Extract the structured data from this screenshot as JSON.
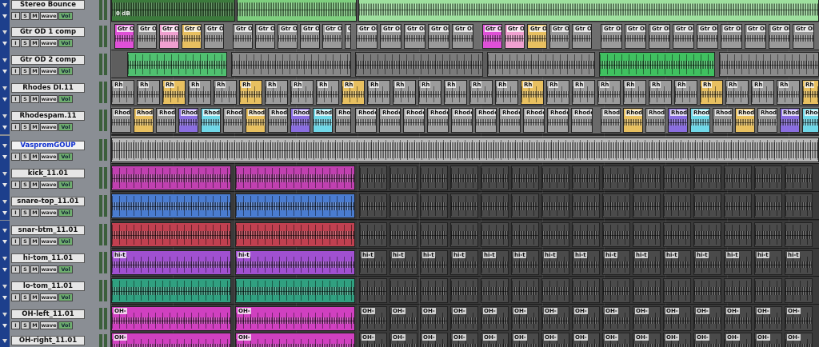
{
  "colors": {
    "header_blue": "#1d3f8c",
    "header_bg": "#8a8e94",
    "stereo_bounce": "#7ecf7e",
    "gtr": "#9a9a9a",
    "gtr_magenta": "#e050d8",
    "gtr_pink": "#f0a0d0",
    "gtr_gold": "#e8c060",
    "rhodes_purple": "#8a6ee0",
    "rhodes_cyan": "#70d8e8",
    "kick": "#c040b0",
    "snare_top": "#4a7cd0",
    "snare_btm": "#c04050",
    "hi_tom": "#a050d0",
    "lo_tom": "#30a080",
    "oh": "#d040c0",
    "drums_default": "#4a4a4a"
  },
  "tracks": [
    {
      "name": "Stereo Bounce",
      "selected": false,
      "button_labels": [
        "I",
        "S",
        "M"
      ],
      "view_label": "wave",
      "volume_label": "Vol",
      "clip_label": ""
    },
    {
      "name": "Gtr OD 1 comp",
      "selected": false,
      "button_labels": [
        "I",
        "S",
        "M"
      ],
      "view_label": "wave",
      "volume_label": "Vol",
      "clip_label": "Gtr Ol"
    },
    {
      "name": "Gtr OD 2 comp",
      "selected": false,
      "button_labels": [
        "I",
        "S",
        "M"
      ],
      "view_label": "wave",
      "volume_label": "Vol",
      "clip_label": ""
    },
    {
      "name": "Rhodes DI.11",
      "selected": false,
      "button_labels": [
        "I",
        "S",
        "M"
      ],
      "view_label": "wave",
      "volume_label": "Vol",
      "clip_label": "Rh"
    },
    {
      "name": "Rhodespam.11",
      "selected": false,
      "button_labels": [
        "I",
        "S",
        "M"
      ],
      "view_label": "wave",
      "volume_label": "Vol",
      "clip_label": "Rhode"
    },
    {
      "name": "VaspromGOUP",
      "selected": true,
      "button_labels": [
        "I",
        "S",
        "M"
      ],
      "view_label": "wave",
      "volume_label": "Vol",
      "clip_label": ""
    },
    {
      "name": "kick_11.01",
      "selected": false,
      "button_labels": [
        "I",
        "S",
        "M"
      ],
      "view_label": "wave",
      "volume_label": "Vol",
      "clip_label": ""
    },
    {
      "name": "snare-top_11.01",
      "selected": false,
      "button_labels": [
        "I",
        "S",
        "M"
      ],
      "view_label": "wave",
      "volume_label": "Vol",
      "clip_label": ""
    },
    {
      "name": "snar-btm_11.01",
      "selected": false,
      "button_labels": [
        "I",
        "S",
        "M"
      ],
      "view_label": "wave",
      "volume_label": "Vol",
      "clip_label": ""
    },
    {
      "name": "hi-tom_11.01",
      "selected": false,
      "button_labels": [
        "I",
        "S",
        "M"
      ],
      "view_label": "wave",
      "volume_label": "Vol",
      "clip_label": "hi-t"
    },
    {
      "name": "lo-tom_11.01",
      "selected": false,
      "button_labels": [
        "I",
        "S",
        "M"
      ],
      "view_label": "wave",
      "volume_label": "Vol",
      "clip_label": ""
    },
    {
      "name": "OH-left_11.01",
      "selected": false,
      "button_labels": [
        "I",
        "S",
        "M"
      ],
      "view_label": "wave",
      "volume_label": "Vol",
      "clip_label": "OH-"
    },
    {
      "name": "OH-right_11.01",
      "selected": false,
      "button_labels": [
        "I",
        "S",
        "M"
      ],
      "view_label": "wave",
      "volume_label": "Vol",
      "clip_label": "OH-"
    }
  ],
  "bounce_overlay_label": "0 dB"
}
